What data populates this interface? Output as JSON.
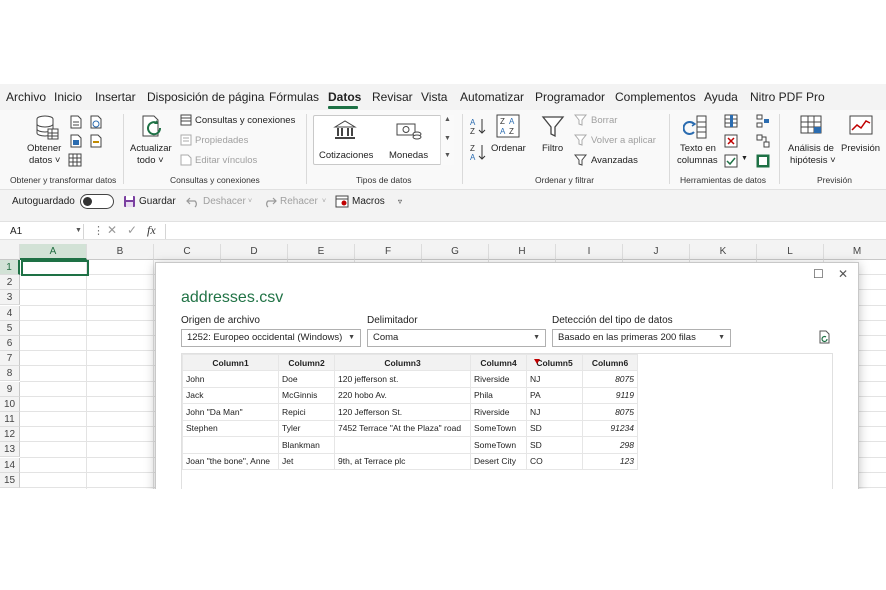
{
  "menu": [
    "Archivo",
    "Inicio",
    "Insertar",
    "Disposición de página",
    "Fórmulas",
    "Datos",
    "Revisar",
    "Vista",
    "Automatizar",
    "Programador",
    "Complementos",
    "Ayuda",
    "Nitro PDF Pro"
  ],
  "active_menu": "Datos",
  "ribbon": {
    "obtener_line1": "Obtener",
    "obtener_line2": "datos ˅",
    "grp_obtener": "Obtener y transformar datos",
    "actualizar_line1": "Actualizar",
    "actualizar_line2": "todo ˅",
    "consultas_conexiones": "Consultas y conexiones",
    "propiedades": "Propiedades",
    "editar_vinculos": "Editar vínculos",
    "grp_consultas": "Consultas y conexiones",
    "cotizaciones": "Cotizaciones",
    "monedas": "Monedas",
    "grp_tipos": "Tipos de datos",
    "ordenar": "Ordenar",
    "filtro": "Filtro",
    "borrar": "Borrar",
    "volver_aplicar": "Volver a aplicar",
    "avanzadas": "Avanzadas",
    "grp_ordenar": "Ordenar y filtrar",
    "texto_line1": "Texto en",
    "texto_line2": "columnas",
    "grp_herramientas": "Herramientas de datos",
    "analisis_line1": "Análisis de",
    "analisis_line2": "hipótesis ˅",
    "prevision": "Previsión",
    "grp_prevision": "Previsión"
  },
  "qat": {
    "autoguardado": "Autoguardado",
    "guardar": "Guardar",
    "deshacer": "Deshacer",
    "rehacer": "Rehacer",
    "macros": "Macros"
  },
  "formula_bar": {
    "name_box": "A1",
    "fx": "fx"
  },
  "grid": {
    "columns": [
      "A",
      "B",
      "C",
      "D",
      "E",
      "F",
      "G",
      "H",
      "I",
      "J",
      "K",
      "L",
      "M"
    ],
    "rows": [
      "1",
      "2",
      "3",
      "4",
      "5",
      "6",
      "7",
      "8",
      "9",
      "10",
      "11",
      "12",
      "13",
      "14",
      "15"
    ],
    "active_cell": "A1"
  },
  "dialog": {
    "title": "addresses.csv",
    "origen_label": "Origen de archivo",
    "origen_value": "1252: Europeo occidental (Windows)",
    "delimitador_label": "Delimitador",
    "delimitador_value": "Coma",
    "deteccion_label": "Detección del tipo de datos",
    "deteccion_value": "Basado en las primeras 200 filas",
    "columns": [
      "Column1",
      "Column2",
      "Column3",
      "Column4",
      "Column5",
      "Column6"
    ],
    "rows": [
      [
        "John",
        "Doe",
        "120 jefferson st.",
        "Riverside",
        "NJ",
        "8075"
      ],
      [
        "Jack",
        "McGinnis",
        "220 hobo Av.",
        "Phila",
        "PA",
        "9119"
      ],
      [
        "John \"Da Man\"",
        "Repici",
        "120 Jefferson St.",
        "Riverside",
        "NJ",
        "8075"
      ],
      [
        "Stephen",
        "Tyler",
        "7452 Terrace \"At the Plaza\" road",
        "SomeTown",
        "SD",
        "91234"
      ],
      [
        "",
        "Blankman",
        "",
        "SomeTown",
        "SD",
        "298"
      ],
      [
        "Joan \"the bone\", Anne",
        "Jet",
        "9th, at Terrace plc",
        "Desert City",
        "CO",
        "123"
      ]
    ]
  },
  "colors": {
    "accent": "#1e7145",
    "title": "#217346"
  }
}
